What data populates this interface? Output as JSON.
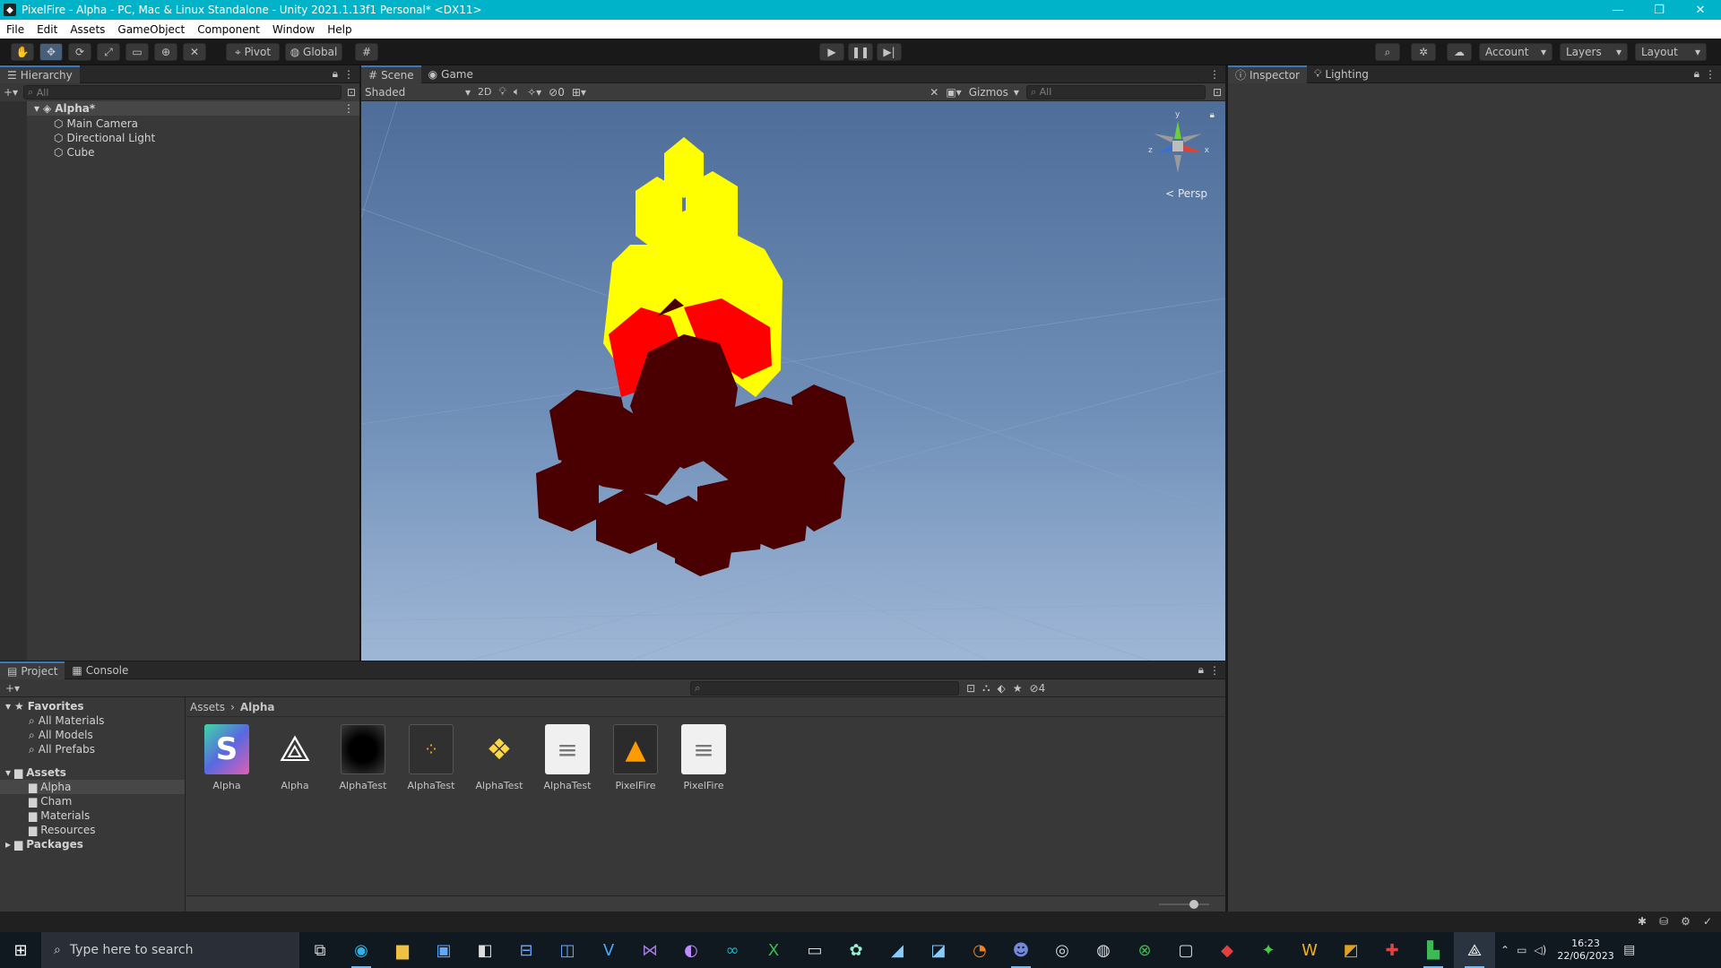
{
  "window": {
    "title": "PixelFire - Alpha - PC, Mac & Linux Standalone - Unity 2021.1.13f1 Personal* <DX11>"
  },
  "menu": [
    "File",
    "Edit",
    "Assets",
    "GameObject",
    "Component",
    "Window",
    "Help"
  ],
  "toolbar": {
    "pivot": "Pivot",
    "global": "Global",
    "account": "Account",
    "layers": "Layers",
    "layout": "Layout"
  },
  "hierarchy": {
    "tab": "Hierarchy",
    "search_placeholder": "All",
    "scene": "Alpha*",
    "items": [
      "Main Camera",
      "Directional Light",
      "Cube"
    ]
  },
  "scene_view": {
    "tabs": [
      "Scene",
      "Game"
    ],
    "shading": "Shaded",
    "mode_2d": "2D",
    "hidden_count": "0",
    "gizmos": "Gizmos",
    "search_placeholder": "All",
    "persp": "< Persp",
    "axes": {
      "y": "y",
      "x": "x",
      "z": "z"
    }
  },
  "inspector": {
    "tabs": [
      "Inspector",
      "Lighting"
    ]
  },
  "project": {
    "tabs": [
      "Project",
      "Console"
    ],
    "hidden_count": "4",
    "breadcrumb": [
      "Assets",
      "Alpha"
    ],
    "favorites": {
      "label": "Favorites",
      "items": [
        "All Materials",
        "All Models",
        "All Prefabs"
      ]
    },
    "assets": {
      "label": "Assets",
      "items": [
        "Alpha",
        "Cham",
        "Materials",
        "Resources"
      ]
    },
    "packages": "Packages",
    "files": [
      {
        "name": "Alpha",
        "icon": "shader-graph-icon"
      },
      {
        "name": "Alpha",
        "icon": "unity-scene-icon"
      },
      {
        "name": "AlphaTest",
        "icon": "material-icon"
      },
      {
        "name": "AlphaTest",
        "icon": "particle-icon"
      },
      {
        "name": "AlphaTest",
        "icon": "python-script-icon"
      },
      {
        "name": "AlphaTest",
        "icon": "text-file-icon"
      },
      {
        "name": "PixelFire",
        "icon": "pixel-fire-prefab-icon"
      },
      {
        "name": "PixelFire",
        "icon": "text-file-icon"
      }
    ]
  },
  "taskbar": {
    "search_placeholder": "Type here to search",
    "time": "16:23",
    "date": "22/06/2023"
  }
}
